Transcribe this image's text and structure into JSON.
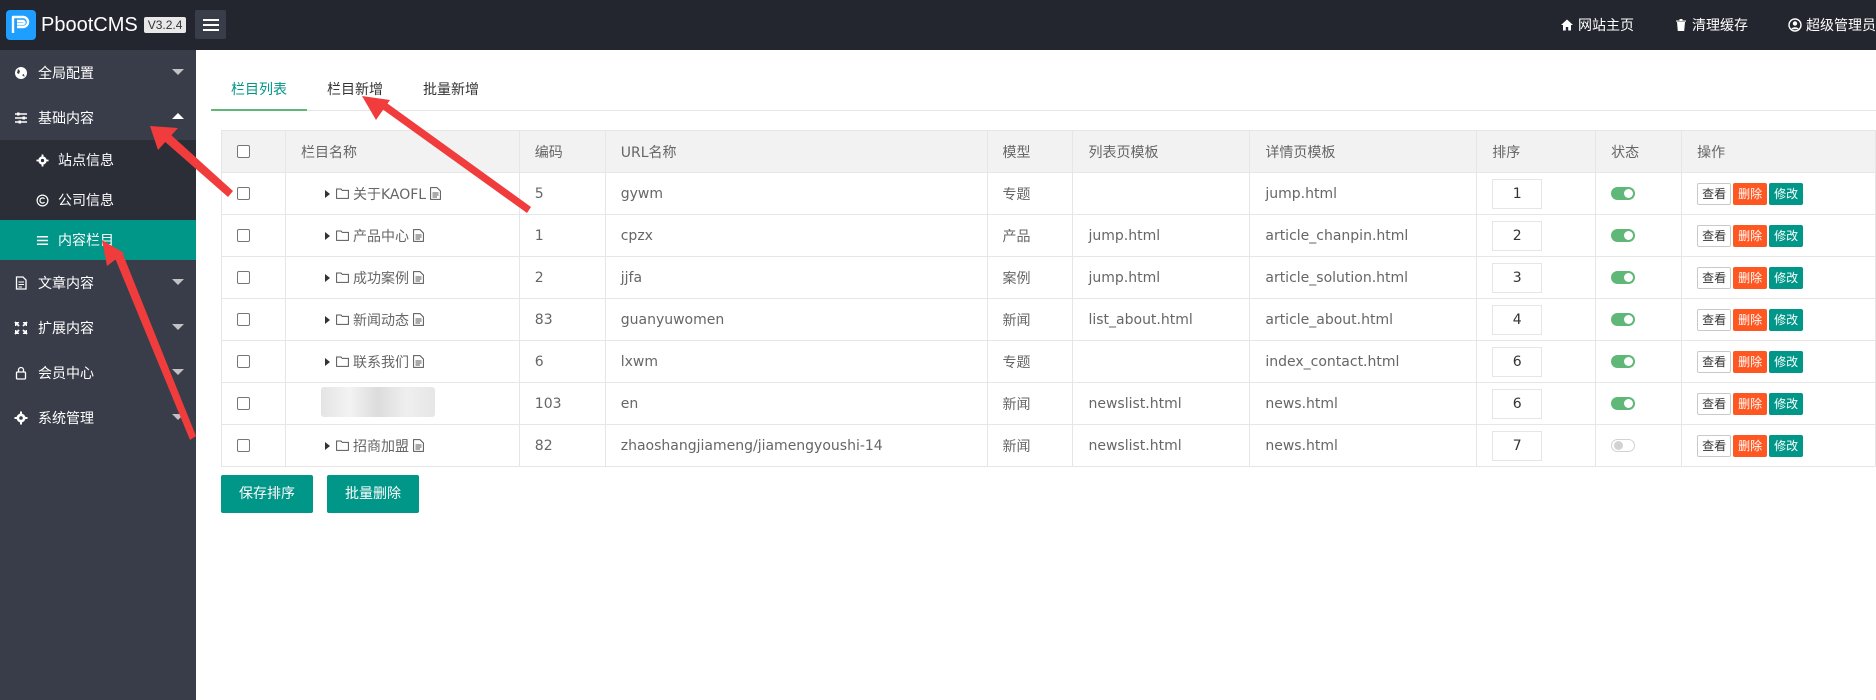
{
  "app": {
    "name": "PbootCMS",
    "version": "V3.2.4"
  },
  "top_links": [
    {
      "label": "网站主页",
      "icon": "home-icon"
    },
    {
      "label": "清理缓存",
      "icon": "trash-icon"
    },
    {
      "label": "超级管理员",
      "icon": "user-circle-icon"
    }
  ],
  "sidebar": {
    "items": [
      {
        "label": "全局配置",
        "icon": "globe-icon"
      },
      {
        "label": "基础内容",
        "icon": "sliders-icon",
        "expanded": true,
        "children": [
          {
            "label": "站点信息",
            "icon": "gear-icon"
          },
          {
            "label": "公司信息",
            "icon": "copyright-icon"
          },
          {
            "label": "内容栏目",
            "icon": "list-icon",
            "active": true
          }
        ]
      },
      {
        "label": "文章内容",
        "icon": "file-icon"
      },
      {
        "label": "扩展内容",
        "icon": "expand-icon"
      },
      {
        "label": "会员中心",
        "icon": "lock-icon"
      },
      {
        "label": "系统管理",
        "icon": "gear-icon"
      }
    ]
  },
  "tabs": [
    {
      "label": "栏目列表",
      "active": true
    },
    {
      "label": "栏目新增"
    },
    {
      "label": "批量新增"
    }
  ],
  "table": {
    "headers": [
      "栏目名称",
      "编码",
      "URL名称",
      "模型",
      "列表页模板",
      "详情页模板",
      "排序",
      "状态",
      "操作"
    ],
    "rows": [
      {
        "name": "关于KAOFL",
        "code": "5",
        "url": "gywm",
        "model": "专题",
        "list_tpl": "",
        "detail_tpl": "jump.html",
        "sort": "1",
        "status": true
      },
      {
        "name": "产品中心",
        "code": "1",
        "url": "cpzx",
        "model": "产品",
        "list_tpl": "jump.html",
        "detail_tpl": "article_chanpin.html",
        "sort": "2",
        "status": true
      },
      {
        "name": "成功案例",
        "code": "2",
        "url": "jjfa",
        "model": "案例",
        "list_tpl": "jump.html",
        "detail_tpl": "article_solution.html",
        "sort": "3",
        "status": true
      },
      {
        "name": "新闻动态",
        "code": "83",
        "url": "guanyuwomen",
        "model": "新闻",
        "list_tpl": "list_about.html",
        "detail_tpl": "article_about.html",
        "sort": "4",
        "status": true
      },
      {
        "name": "联系我们",
        "code": "6",
        "url": "lxwm",
        "model": "专题",
        "list_tpl": "",
        "detail_tpl": "index_contact.html",
        "sort": "6",
        "status": true
      },
      {
        "name": "",
        "code": "103",
        "url": "en",
        "model": "新闻",
        "list_tpl": "newslist.html",
        "detail_tpl": "news.html",
        "sort": "6",
        "status": true,
        "blurred": true
      },
      {
        "name": "招商加盟",
        "code": "82",
        "url": "zhaoshangjiameng/jiamengyoushi-14",
        "model": "新闻",
        "list_tpl": "newslist.html",
        "detail_tpl": "news.html",
        "sort": "7",
        "status": false
      }
    ],
    "ops": {
      "view": "查看",
      "delete": "删除",
      "edit": "修改"
    }
  },
  "buttons": {
    "save_sort": "保存排序",
    "batch_delete": "批量删除"
  },
  "colors": {
    "topbar": "#23262e",
    "sidebar": "#393d49",
    "accent": "#009688",
    "danger": "#ff5722",
    "switch_on": "#5fb878",
    "annotation_arrow": "#f03c3c"
  }
}
